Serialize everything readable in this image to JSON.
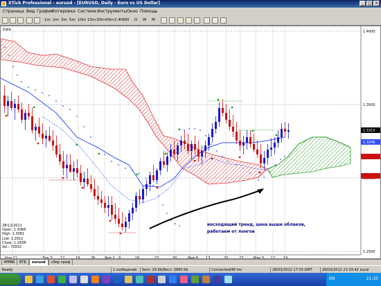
{
  "window": {
    "title": "XTick Professional - eurusd - [EURUSD, Daily - Euro vs US Dollar]"
  },
  "menu": [
    "Страница",
    "Вид",
    "График",
    "Котировки",
    "Система",
    "Инструменты",
    "Окно",
    "Помощь"
  ],
  "toolbar": {
    "timeframes": [
      "1m",
      "2m",
      "3m",
      "5m",
      "10m",
      "15m",
      "30m",
      "60m",
      "2.4h",
      "360",
      "D",
      "W",
      "M"
    ]
  },
  "chart": {
    "data_label": "Data",
    "price_labels": [
      "1.4000",
      "1.3500",
      "1.3315",
      "1.3246",
      "1.3000",
      "1.2500"
    ],
    "current_price": "1.3315",
    "blue_price": "1.3246",
    "date_labels": [
      "Ноя 21",
      "Дек 5",
      "12",
      "19",
      "26",
      "Янв 2",
      "9",
      "16",
      "23",
      "30",
      "Фев 6",
      "13",
      "20",
      "27",
      "Мар 5",
      "12",
      "19",
      "26"
    ],
    "info": {
      "date": "28/12/2011",
      "open": "Open: 1.3068",
      "high": "High: 1.3081",
      "low": "Low: 1.2912",
      "close": "Close: 1.2938",
      "vol": "Vol.: 72832"
    },
    "annotation_line1": "восходящий тренд, цена выше облаков,",
    "annotation_line2": "работаем от лонгов",
    "colors": {
      "bull": "#1a1acc",
      "bear": "#cc1010",
      "kijun": "#3050ff",
      "tenkan": "#3050ff",
      "cloud_bear": "#e03030",
      "cloud_bull": "#30a030"
    }
  },
  "tabs": [
    "ММВБ",
    "ВТБ",
    "eurusd",
    "сбер преф"
  ],
  "status": {
    "ready": "Ready",
    "messages": "1 сообщений",
    "sent": "Sent: 29 Kb/Recv: 3660 Kb",
    "connected": "Connected/48 ms",
    "time1": "28/03/2012 17:33 GMT",
    "time2": "28/03/2012 21:33:42 Local"
  },
  "taskbar": {
    "lang": "EN",
    "clock": "21:33"
  }
}
